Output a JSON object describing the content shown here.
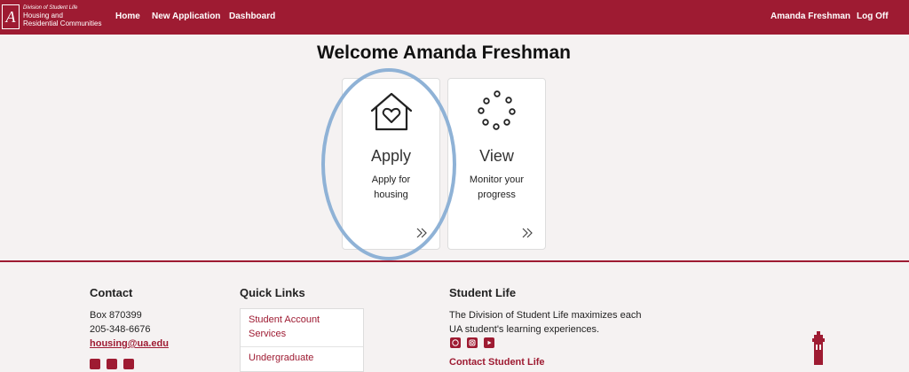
{
  "brand": {
    "division": "Division of Student Life",
    "name_line1": "Housing and",
    "name_line2": "Residential Communities",
    "logo_letter": "A"
  },
  "nav": {
    "home": "Home",
    "new_application": "New Application",
    "dashboard": "Dashboard",
    "user": "Amanda Freshman",
    "logoff": "Log Off"
  },
  "page": {
    "title": "Welcome Amanda Freshman"
  },
  "cards": [
    {
      "title": "Apply",
      "desc_line1": "Apply for",
      "desc_line2": "housing",
      "icon": "house-heart-icon"
    },
    {
      "title": "View",
      "desc_line1": "Monitor your",
      "desc_line2": "progress",
      "icon": "loading-dots-icon"
    }
  ],
  "footer": {
    "contact": {
      "heading": "Contact",
      "box": "Box 870399",
      "phone": "205-348-6676",
      "email": "housing@ua.edu"
    },
    "quick_links": {
      "heading": "Quick Links",
      "item1_line1": "Student Account",
      "item1_line2": "Services",
      "item2": "Undergraduate"
    },
    "student_life": {
      "heading": "Student Life",
      "text_line1": "The Division of Student Life maximizes each",
      "text_line2": "UA student's learning experiences.",
      "contact_link": "Contact Student Life"
    },
    "social": [
      "facebook-icon",
      "instagram-icon",
      "youtube-icon"
    ]
  },
  "colors": {
    "brand": "#9e1b32",
    "annotation": "#8fb2d6"
  }
}
